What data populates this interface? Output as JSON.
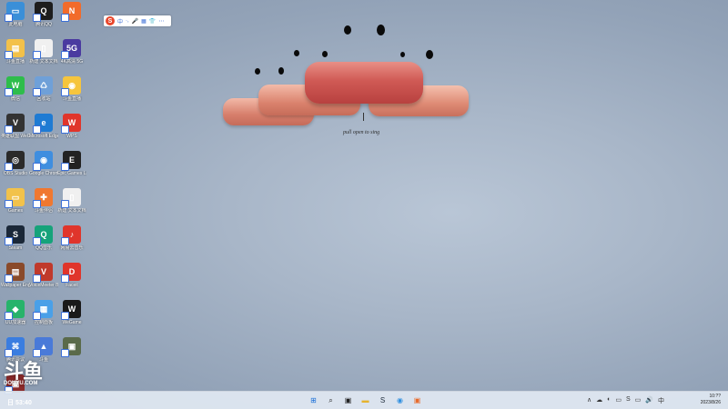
{
  "desktop": {
    "icons": [
      {
        "label": "此电脑",
        "color": "#3a8fd8",
        "glyph": "▭"
      },
      {
        "label": "腾讯QQ",
        "color": "#1d1d1d",
        "glyph": "Q"
      },
      {
        "label": "",
        "color": "#f26b2a",
        "glyph": "N"
      },
      {
        "label": "斗鱼直播",
        "color": "#f3c14a",
        "glyph": "▤"
      },
      {
        "label": "新建 文本文档",
        "color": "#f0f0f0",
        "glyph": "▯"
      },
      {
        "label": "4K高清 5G",
        "color": "#4a3aa0",
        "glyph": "5G"
      },
      {
        "label": "微信",
        "color": "#2ebd4b",
        "glyph": "W"
      },
      {
        "label": "回收站",
        "color": "#6fa0d8",
        "glyph": "♺"
      },
      {
        "label": "斗鱼直播",
        "color": "#f6c53d",
        "glyph": "◉"
      },
      {
        "label": "英雄联盟 WeGame版",
        "color": "#333333",
        "glyph": "V"
      },
      {
        "label": "Microsoft Edge",
        "color": "#1f7bd3",
        "glyph": "e"
      },
      {
        "label": "WPS",
        "color": "#e0352b",
        "glyph": "W"
      },
      {
        "label": "OBS Studio",
        "color": "#2a2a2a",
        "glyph": "◎"
      },
      {
        "label": "Google Chrome",
        "color": "#3f8edf",
        "glyph": "◉"
      },
      {
        "label": "Epic Games Launcher",
        "color": "#222222",
        "glyph": "E"
      },
      {
        "label": "Games",
        "color": "#f2c24b",
        "glyph": "▭"
      },
      {
        "label": "斗鱼伴侣",
        "color": "#f07830",
        "glyph": "✚"
      },
      {
        "label": "新建 文本文档",
        "color": "#f0f0f0",
        "glyph": "▯"
      },
      {
        "label": "Steam",
        "color": "#1b2838",
        "glyph": "S"
      },
      {
        "label": "QQ音乐",
        "color": "#16a37a",
        "glyph": "Q"
      },
      {
        "label": "网易云音乐",
        "color": "#e0352b",
        "glyph": "♪"
      },
      {
        "label": "Wallpaper Engine",
        "color": "#8a4a2a",
        "glyph": "▤"
      },
      {
        "label": "VoiceMeeter Banana",
        "color": "#c0392b",
        "glyph": "V"
      },
      {
        "label": "Faceit",
        "color": "#e0352b",
        "glyph": "D"
      },
      {
        "label": "UU加速器",
        "color": "#27b36b",
        "glyph": "◆"
      },
      {
        "label": "控制面板",
        "color": "#4aa0e8",
        "glyph": "▦"
      },
      {
        "label": "WeGame",
        "color": "#1a1a1a",
        "glyph": "W"
      },
      {
        "label": "腾讯会议",
        "color": "#3a7de0",
        "glyph": "⌘"
      },
      {
        "label": "斗鱼",
        "color": "#4a7ad8",
        "glyph": "▲"
      },
      {
        "label": "",
        "color": "#5a6a4a",
        "glyph": "▣"
      },
      {
        "label": "",
        "color": "#8a2a2a",
        "glyph": "▣"
      }
    ]
  },
  "ime_toolbar": {
    "logo": "S",
    "items": [
      "中",
      "·,",
      "🎤",
      "▦",
      "👕",
      "⋯"
    ]
  },
  "art": {
    "caption": "pull open to sing"
  },
  "watermark": {
    "brand": "斗鱼",
    "domain": "DOUYU.COM"
  },
  "overlay": {
    "text": "日 53:40"
  },
  "taskbar": {
    "apps": [
      {
        "name": "start",
        "glyph": "⊞",
        "color": "#1a6fd8"
      },
      {
        "name": "search",
        "glyph": "⌕",
        "color": "#222"
      },
      {
        "name": "task-view",
        "glyph": "▣",
        "color": "#222"
      },
      {
        "name": "file-explorer",
        "glyph": "▬",
        "color": "#e6b32e"
      },
      {
        "name": "steam",
        "glyph": "S",
        "color": "#1b2838"
      },
      {
        "name": "chrome",
        "glyph": "◉",
        "color": "#2f8fe0"
      },
      {
        "name": "app",
        "glyph": "▣",
        "color": "#e86a2a"
      }
    ],
    "tray": [
      "∧",
      "☁",
      "◐",
      "▭",
      "S",
      "▭",
      "🔊",
      "中"
    ],
    "time": "10:??",
    "date": "2023/8/26"
  }
}
